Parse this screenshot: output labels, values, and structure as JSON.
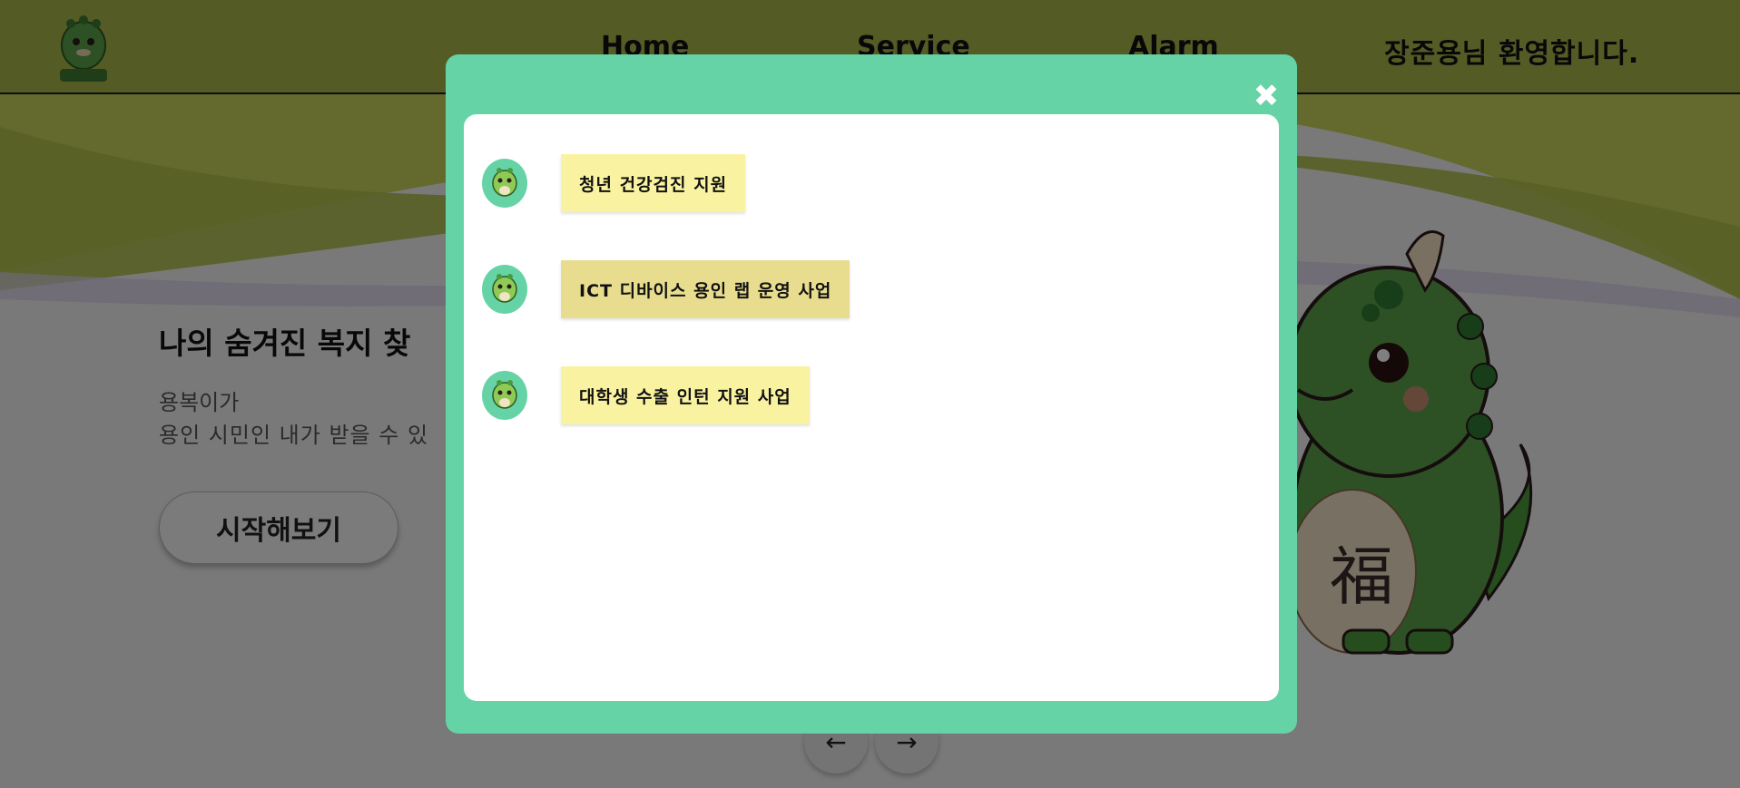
{
  "header": {
    "nav": [
      "Home",
      "Service",
      "Alarm"
    ],
    "welcome": "장준용님 환영합니다."
  },
  "hero": {
    "title": "나의 숨겨진 복지 찾",
    "line1": "용복이가",
    "line2": "용인 시민인 내가 받을 수 있",
    "start_button": "시작해보기",
    "prev_arrow": "←",
    "next_arrow": "→",
    "dragon_belly_char": "福"
  },
  "modal": {
    "close_icon": "✖",
    "items": [
      {
        "label": "청년 건강검진 지원",
        "highlighted": false
      },
      {
        "label": "ICT 디바이스 용인 랩 운영 사업",
        "highlighted": true
      },
      {
        "label": "대학생 수출 인턴 지원 사업",
        "highlighted": false
      }
    ]
  },
  "colors": {
    "header_bg": "#a8b64a",
    "modal_accent": "#66d3a7",
    "bubble": "#f9f3a1",
    "bubble_hover": "#e8dd8f",
    "dragon_green": "#4a9a3a"
  },
  "icons": {
    "logo": "dragon-mascot-logo",
    "avatar": "dragon-mascot-avatar",
    "close": "close-icon",
    "prev": "arrow-left-icon",
    "next": "arrow-right-icon"
  }
}
